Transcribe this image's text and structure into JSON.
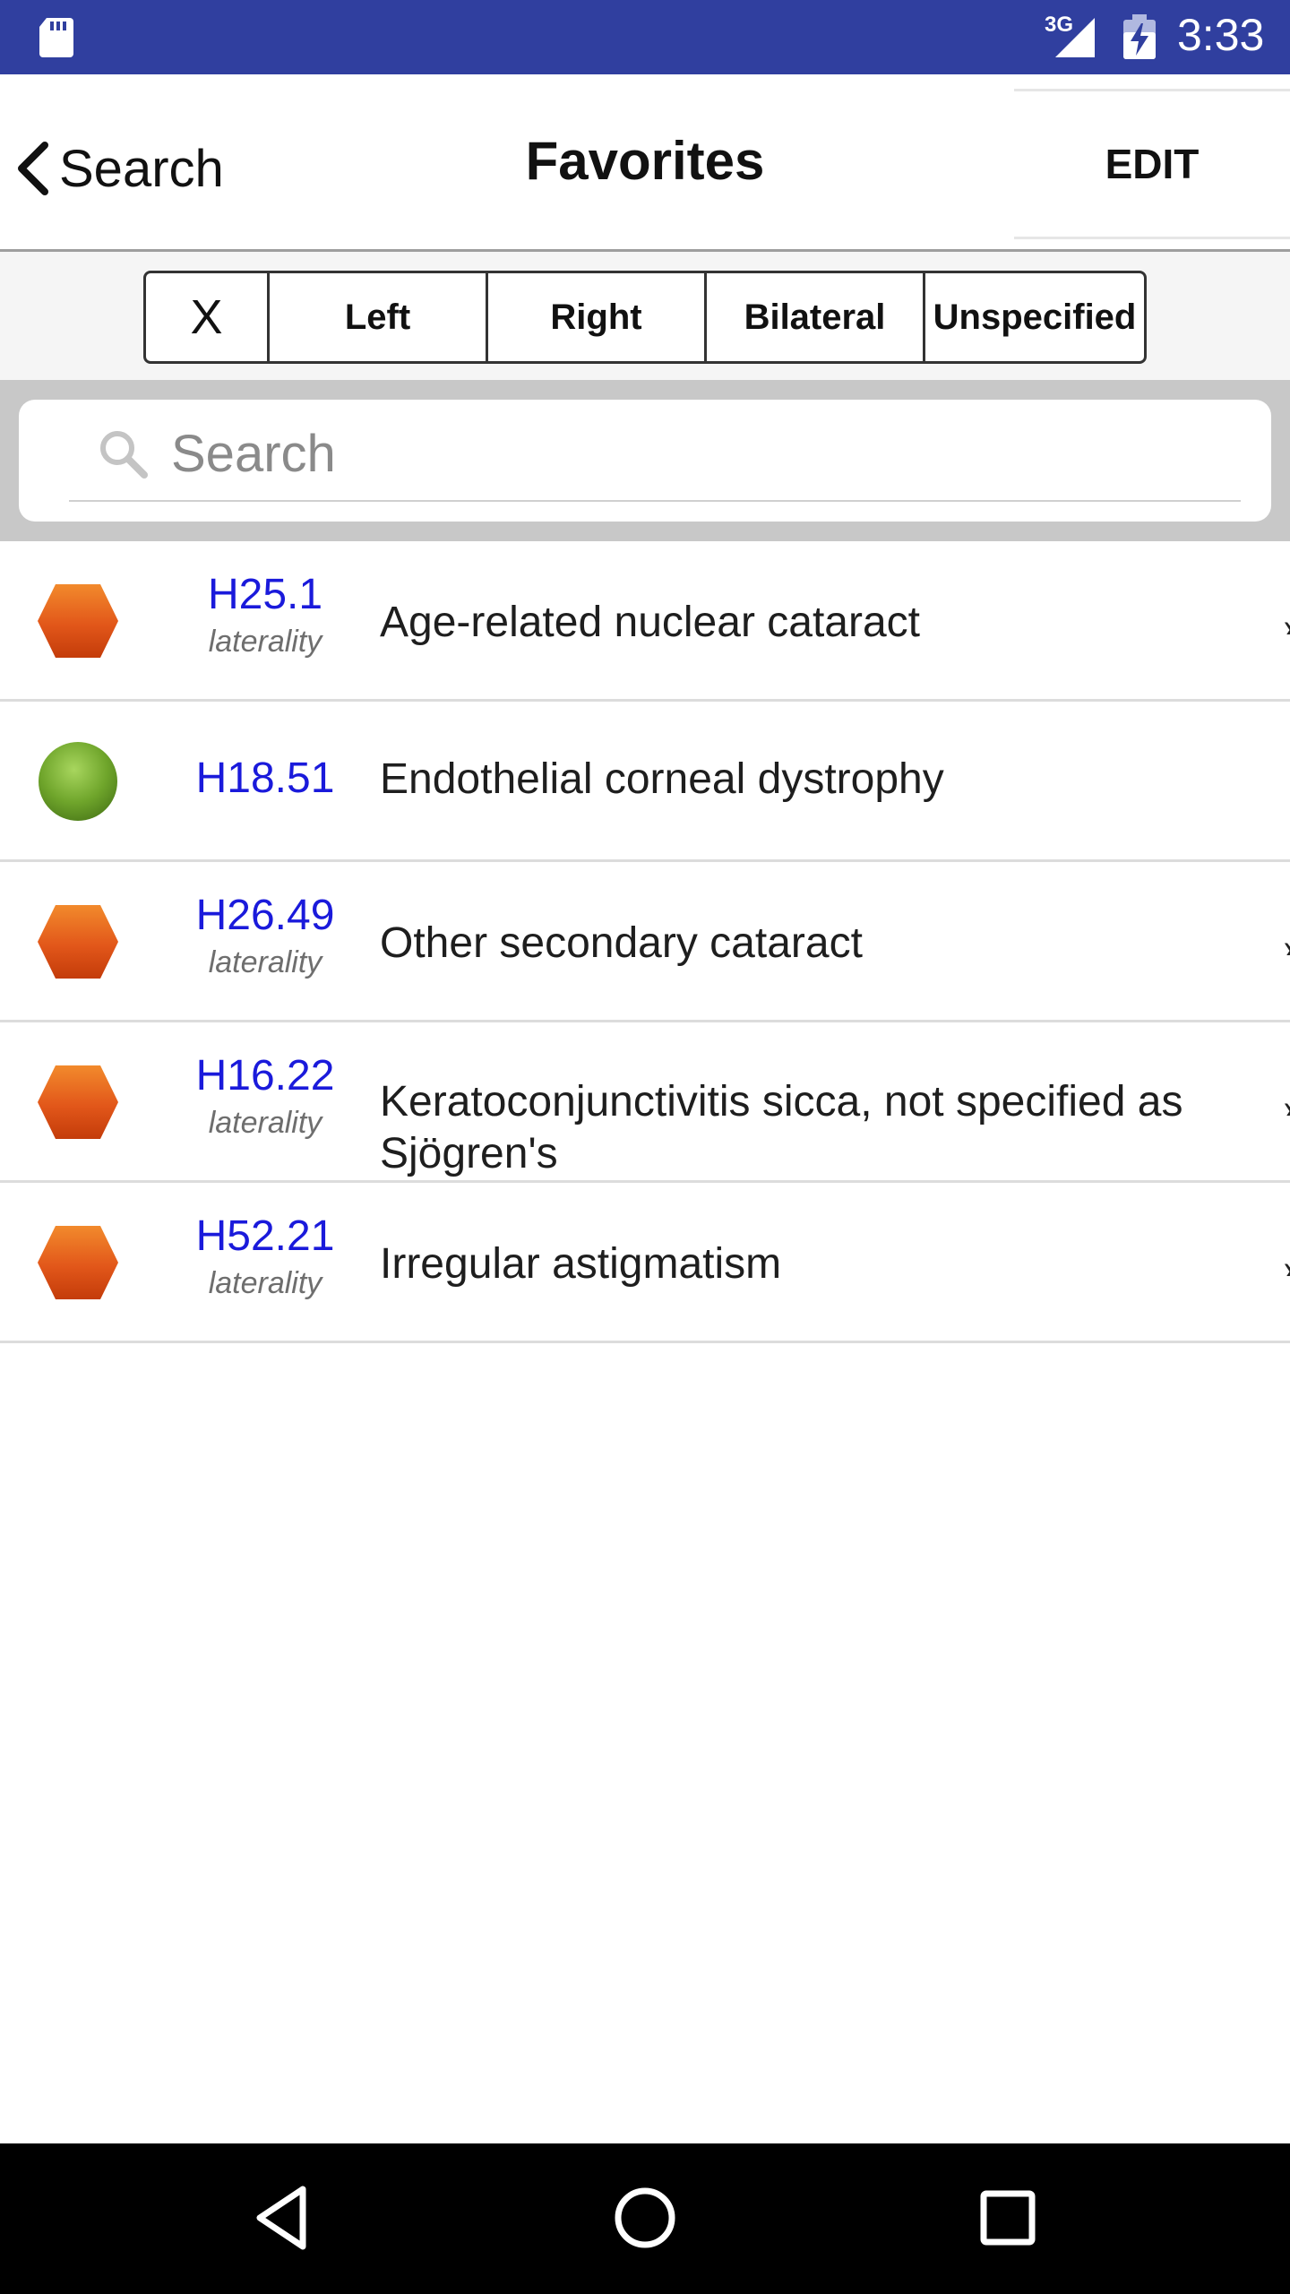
{
  "status_bar": {
    "network": "3G",
    "time": "3:33"
  },
  "header": {
    "back_label": "Search",
    "title": "Favorites",
    "edit_label": "EDIT"
  },
  "filters": {
    "clear": "X",
    "left": "Left",
    "right": "Right",
    "bilateral": "Bilateral",
    "unspecified": "Unspecified"
  },
  "search": {
    "placeholder": "Search",
    "value": ""
  },
  "favorites": [
    {
      "code": "H25.1",
      "laterality": "laterality",
      "description": "Age-related nuclear cataract",
      "status": "hexagon-orange"
    },
    {
      "code": "H18.51",
      "laterality": "",
      "description": "Endothelial corneal dystrophy",
      "status": "circle-green"
    },
    {
      "code": "H26.49",
      "laterality": "laterality",
      "description": "Other secondary cataract",
      "status": "hexagon-orange"
    },
    {
      "code": "H16.22",
      "laterality": "laterality",
      "description": "Keratoconjunctivitis sicca, not specified as Sjögren's",
      "status": "hexagon-orange"
    },
    {
      "code": "H52.21",
      "laterality": "laterality",
      "description": "Irregular astigmatism",
      "status": "hexagon-orange"
    }
  ],
  "colors": {
    "status_bar": "#303f9f",
    "code_link": "#1a1adb",
    "hexagon_orange": "#e8560e",
    "circle_green": "#6fa52b"
  },
  "icons": {
    "back": "chevron-left-icon",
    "search": "magnifier-icon",
    "sys_back": "triangle-back-icon",
    "sys_home": "circle-home-icon",
    "sys_recents": "square-recents-icon"
  }
}
